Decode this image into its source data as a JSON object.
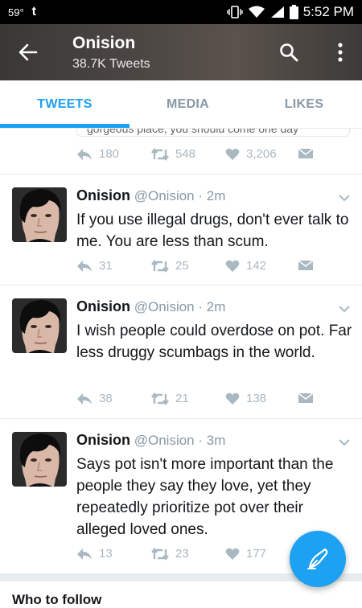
{
  "status_bar": {
    "temperature": "59°",
    "app_icon": "t",
    "time": "5:52 PM",
    "icons": [
      "vibrate-icon",
      "wifi-icon",
      "signal-icon",
      "battery-icon"
    ]
  },
  "header": {
    "title": "Onision",
    "subtitle": "38.7K Tweets",
    "back_icon": "back-arrow-icon",
    "search_icon": "search-icon",
    "more_icon": "more-vertical-icon"
  },
  "tabs": [
    {
      "label": "TWEETS",
      "active": true
    },
    {
      "label": "MEDIA",
      "active": false
    },
    {
      "label": "LIKES",
      "active": false
    }
  ],
  "previous_tweet": {
    "partial_text": "gorgeous place, you should come one day",
    "replies": "180",
    "retweets": "548",
    "likes": "3,206"
  },
  "tweets": [
    {
      "name": "Onision",
      "handle": "@Onision · 2m",
      "text": "If you use illegal drugs, don't ever talk to me. You are less than scum.",
      "replies": "31",
      "retweets": "25",
      "likes": "142"
    },
    {
      "name": "Onision",
      "handle": "@Onision · 2m",
      "text": "I wish people could overdose on pot. Far less druggy scumbags in the world.",
      "replies": "38",
      "retweets": "21",
      "likes": "138"
    },
    {
      "name": "Onision",
      "handle": "@Onision · 3m",
      "text": "Says pot isn't more important than the people they say they love, yet they repeatedly prioritize pot over their alleged loved ones.",
      "replies": "13",
      "retweets": "23",
      "likes": "177"
    }
  ],
  "compose_icon": "compose-tweet-icon",
  "who_to_follow": "Who to follow",
  "colors": {
    "accent": "#1da1f2",
    "muted": "#aab8c2",
    "text": "#14171a"
  }
}
